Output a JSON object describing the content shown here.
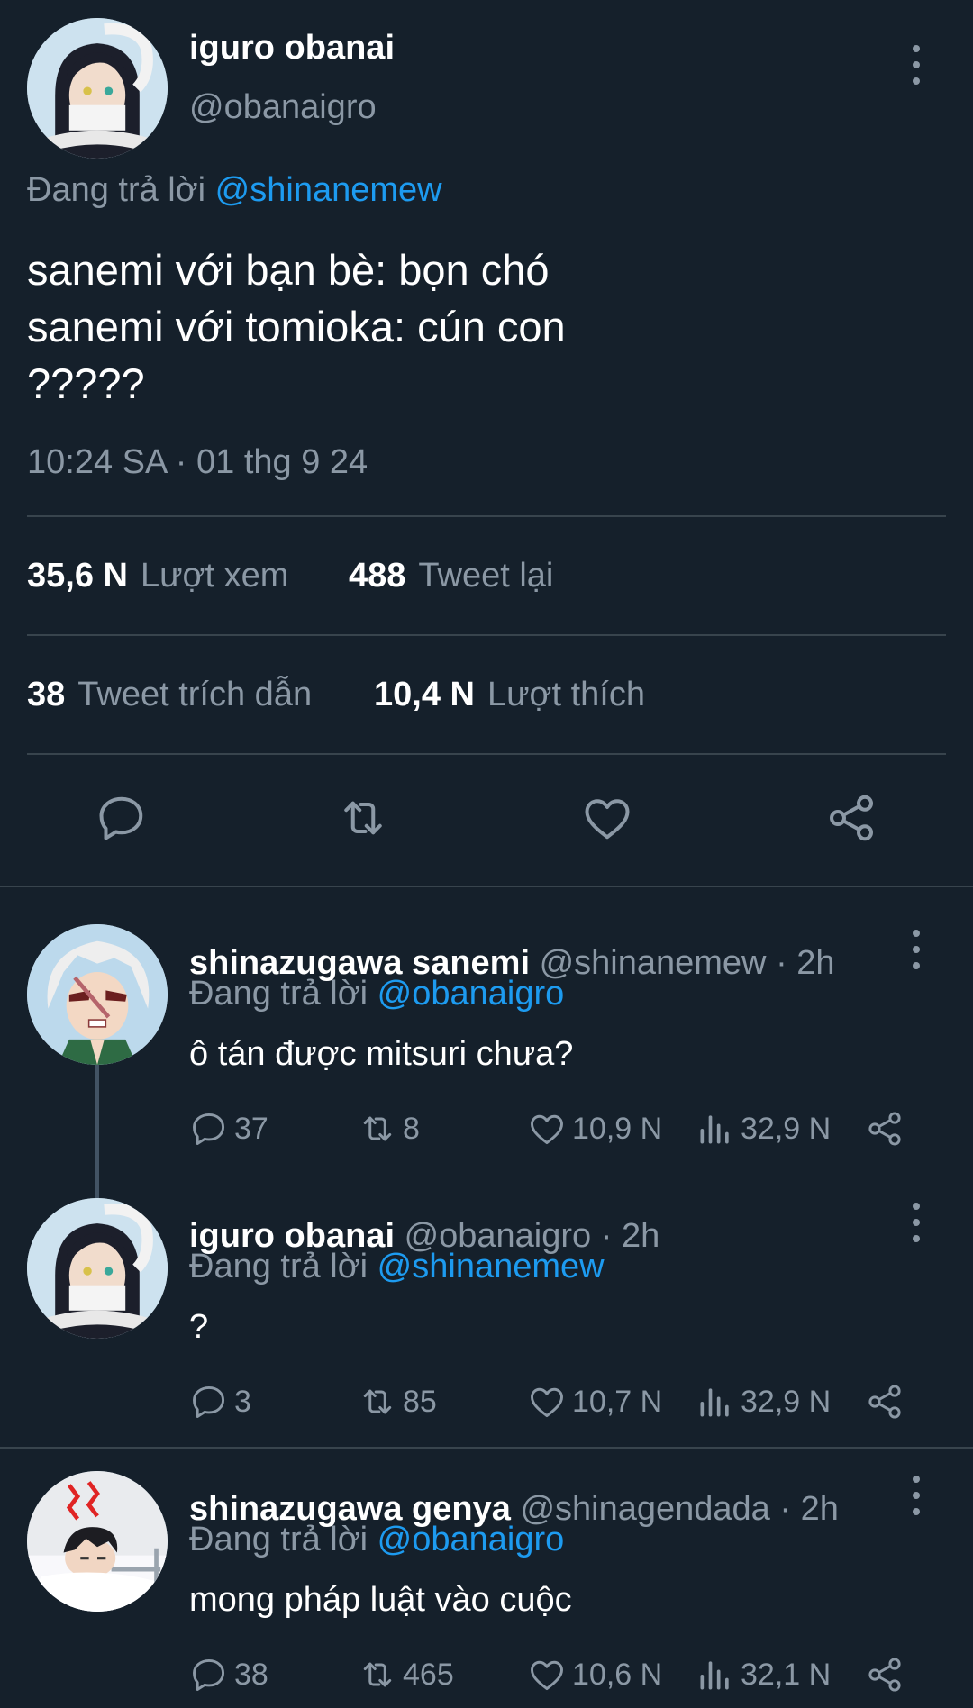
{
  "main_tweet": {
    "author_name": "iguro obanai",
    "author_handle": "@obanaigro",
    "replying_prefix": "Đang trả lời",
    "replying_to": "@shinanemew",
    "text_lines": [
      "sanemi với bạn bè: bọn chó",
      "sanemi với tomioka: cún con",
      "?????"
    ],
    "timestamp": "10:24 SA · 01 thg 9 24",
    "stats": {
      "views_count": "35,6 N",
      "views_label": "Lượt xem",
      "retweets_count": "488",
      "retweets_label": "Tweet lại",
      "quotes_count": "38",
      "quotes_label": "Tweet trích dẫn",
      "likes_count": "10,4 N",
      "likes_label": "Lượt thích"
    },
    "actions": [
      "reply-icon",
      "retweet-icon",
      "like-icon",
      "share-icon"
    ]
  },
  "replies": [
    {
      "name": "shinazugawa sanemi",
      "handle": "@shinanemew",
      "time": "· 2h",
      "replying_prefix": "Đang trả lời",
      "replying_to": "@obanaigro",
      "text": "ô tán được mitsuri chưa?",
      "replies": "37",
      "retweets": "8",
      "likes": "10,9 N",
      "views": "32,9 N"
    },
    {
      "name": "iguro obanai",
      "handle": "@obanaigro",
      "time": "· 2h",
      "replying_prefix": "Đang trả lời",
      "replying_to": "@shinanemew",
      "text": "?",
      "replies": "3",
      "retweets": "85",
      "likes": "10,7 N",
      "views": "32,9 N"
    },
    {
      "name": "shinazugawa genya",
      "handle": "@shinagendada",
      "time": "· 2h",
      "replying_prefix": "Đang trả lời",
      "replying_to": "@obanaigro",
      "text": "mong pháp luật vào cuộc",
      "replies": "38",
      "retweets": "465",
      "likes": "10,6 N",
      "views": "32,1 N"
    }
  ],
  "colors": {
    "background": "#15202b",
    "link": "#1d9bf0",
    "muted": "#8b98a5",
    "divider": "#38444d"
  }
}
